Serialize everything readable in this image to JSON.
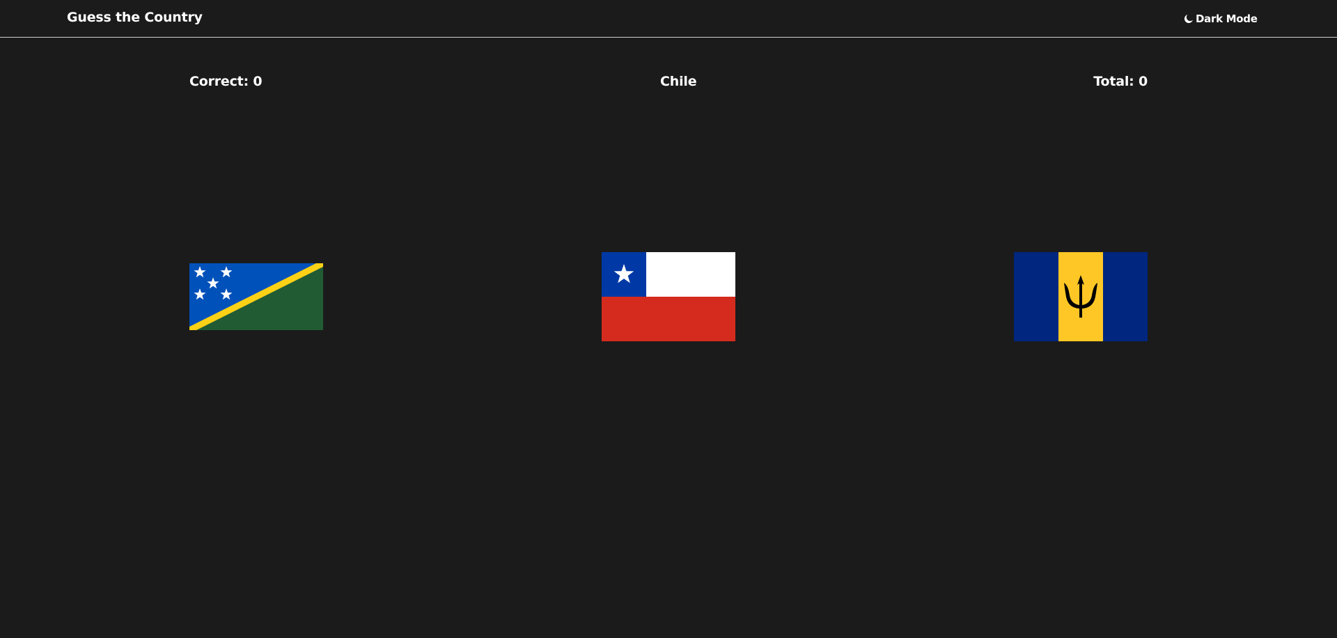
{
  "header": {
    "title": "Guess the Country",
    "theme_toggle": {
      "icon": "moon-icon",
      "label": "Dark Mode"
    }
  },
  "game": {
    "correct_label": "Correct: 0",
    "target_country": "Chile",
    "total_label": "Total: 0",
    "flags": [
      {
        "country": "Solomon Islands",
        "icon": "solomon-islands-flag"
      },
      {
        "country": "Chile",
        "icon": "chile-flag"
      },
      {
        "country": "Barbados",
        "icon": "barbados-flag"
      }
    ]
  },
  "colors": {
    "background": "#1b1b1b",
    "text": "#ffffff",
    "divider": "#cfcfcf"
  }
}
